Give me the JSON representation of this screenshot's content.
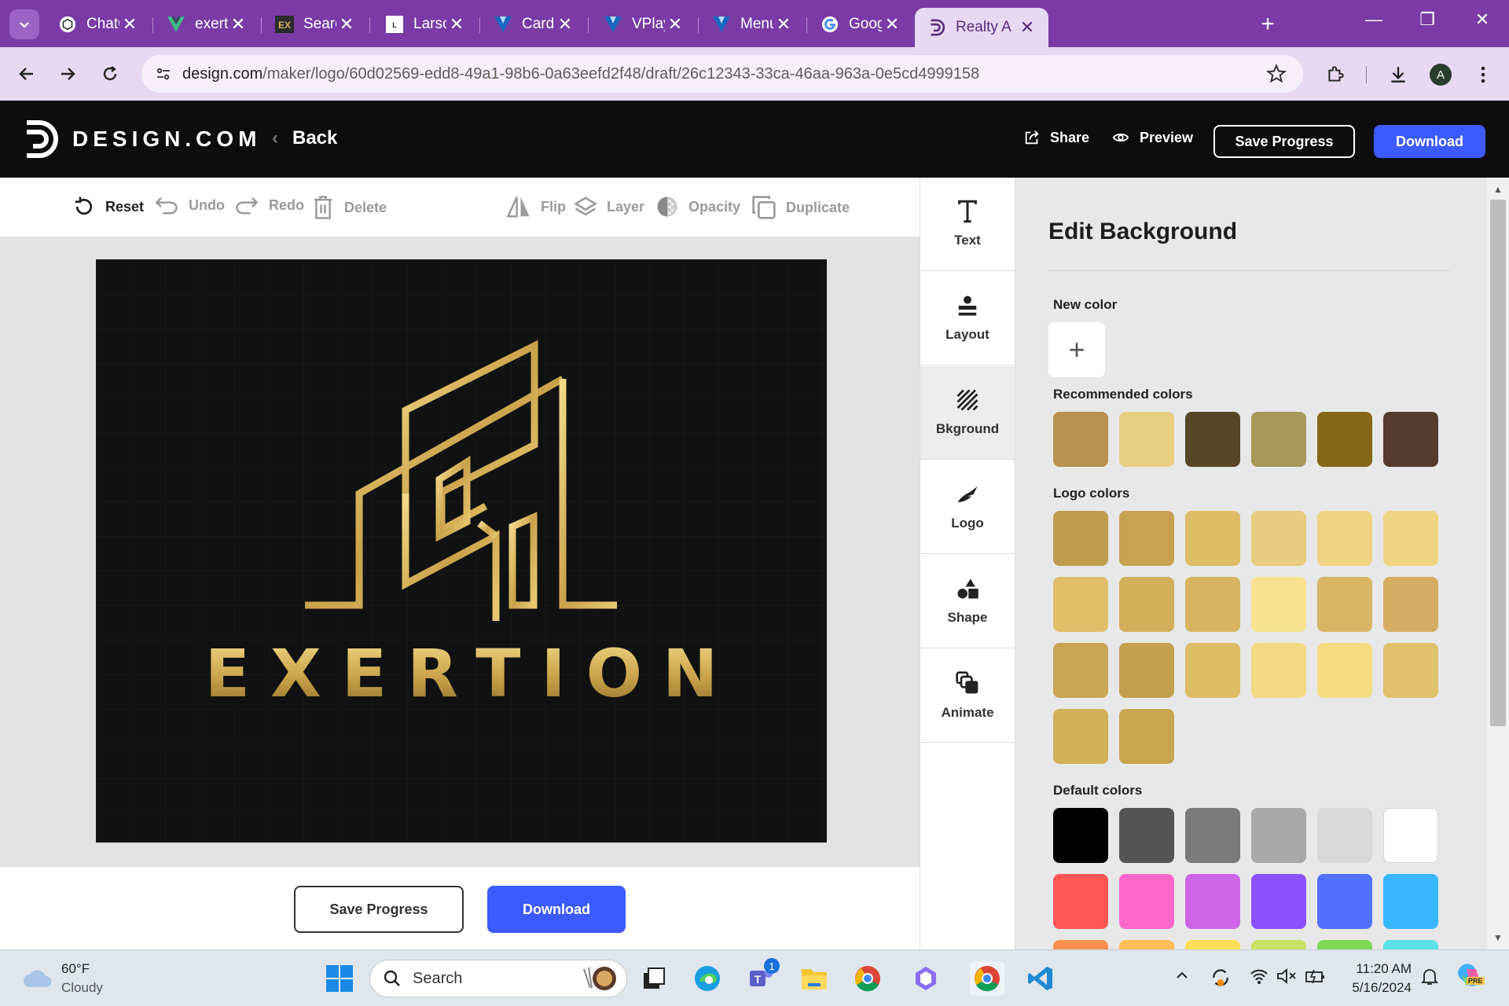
{
  "browser": {
    "tabs": [
      {
        "title": "ChatGPT",
        "icon": "chatgpt-icon",
        "active": false
      },
      {
        "title": "exertion",
        "icon": "vue-icon",
        "active": false
      },
      {
        "title": "Search R",
        "icon": "ex-logo-icon",
        "active": false
      },
      {
        "title": "Larson I",
        "icon": "larson-icon",
        "active": false
      },
      {
        "title": "Card co",
        "icon": "v-icon",
        "active": false
      },
      {
        "title": "VPlay",
        "icon": "v-icon",
        "active": false
      },
      {
        "title": "Menu c",
        "icon": "v-icon",
        "active": false
      },
      {
        "title": "Google",
        "icon": "google-icon",
        "active": false
      },
      {
        "title": "Realty A",
        "icon": "design-logo-icon",
        "active": true
      }
    ],
    "url_host": "design.com",
    "url_path": "/maker/logo/60d02569-edd8-49a1-98b6-0a63eefd2f48/draft/26c12343-33ca-46aa-963a-0e5cd4999158",
    "profile_initial": "A"
  },
  "header": {
    "brand": "DESIGN.COM",
    "back": "Back",
    "share": "Share",
    "preview": "Preview",
    "save_progress": "Save Progress",
    "download": "Download"
  },
  "toolbar": {
    "reset": "Reset",
    "undo": "Undo",
    "redo": "Redo",
    "delete": "Delete",
    "flip": "Flip",
    "layer": "Layer",
    "opacity": "Opacity",
    "duplicate": "Duplicate"
  },
  "canvas": {
    "wordmark": "EXERTION",
    "background_color": "#111111",
    "logo_gold": "#d4b25a"
  },
  "bottom": {
    "save_progress": "Save Progress",
    "download": "Download"
  },
  "side_nav": [
    {
      "label": "Text",
      "icon": "text-icon"
    },
    {
      "label": "Layout",
      "icon": "layout-icon"
    },
    {
      "label": "Bkground",
      "icon": "background-icon"
    },
    {
      "label": "Logo",
      "icon": "logo-icon"
    },
    {
      "label": "Shape",
      "icon": "shape-icon"
    },
    {
      "label": "Animate",
      "icon": "animate-icon"
    }
  ],
  "panel": {
    "title": "Edit Background",
    "new_color_label": "New color",
    "new_color_button": "+",
    "recommended_label": "Recommended colors",
    "recommended": [
      "#b8924e",
      "#e8cf80",
      "#564626",
      "#a8995a",
      "#836818",
      "#553b2d"
    ],
    "logo_label": "Logo colors",
    "logo_colors": [
      "#c09c4e",
      "#c8a252",
      "#ddbd68",
      "#e8cd7f",
      "#efd483",
      "#efd483",
      "#dfbf6a",
      "#d2af5b",
      "#d6b461",
      "#f9e391",
      "#d9b566",
      "#d4ad63",
      "#c9a556",
      "#c3a04f",
      "#ddbd68",
      "#f3d985",
      "#f5dc84",
      "#dfc06c",
      "#d2b05a",
      "#c9a552"
    ],
    "default_label": "Default colors",
    "default_colors": [
      "#000000",
      "#555555",
      "#7a7a7a",
      "#a8a8a8",
      "#d9d9d9",
      "#ffffff",
      "#ff5555",
      "#ff66cc",
      "#cc66e6",
      "#8c52ff",
      "#5271ff",
      "#38b6ff",
      "#ff914d",
      "#ffbd59",
      "#ffde59",
      "#c9e265",
      "#7ed957",
      "#5ce1e6"
    ]
  },
  "taskbar": {
    "temperature": "60°F",
    "condition": "Cloudy",
    "search_placeholder": "Search",
    "time": "11:20 AM",
    "date": "5/16/2024",
    "teams_badge": "1",
    "copilot_badge": "PRE"
  }
}
